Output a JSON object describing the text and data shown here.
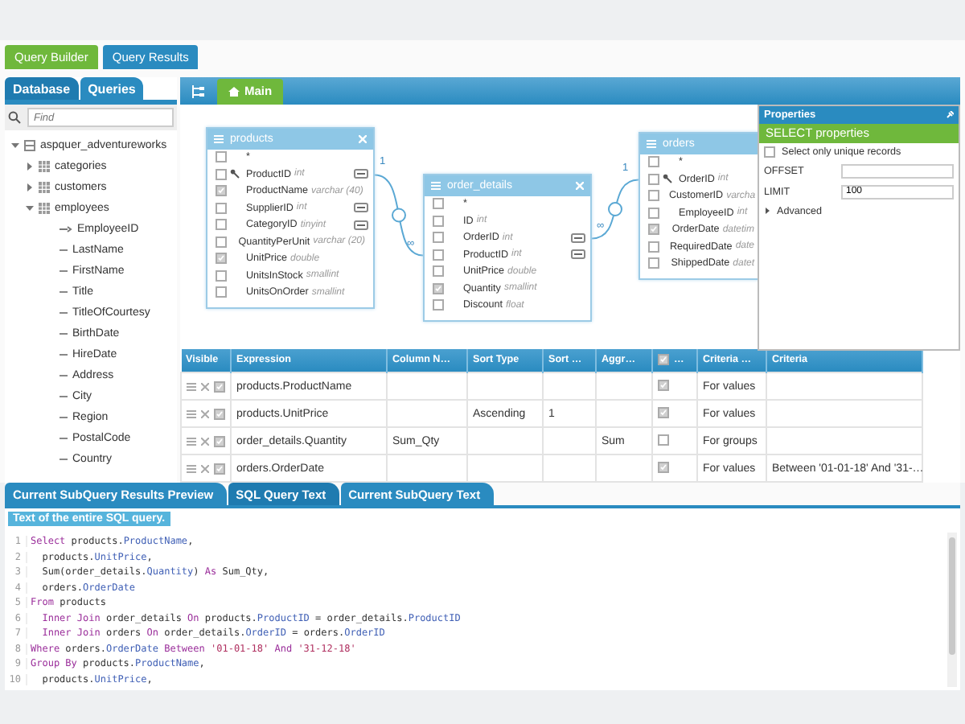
{
  "top_tabs": [
    {
      "label": "Query Builder",
      "selected": true
    },
    {
      "label": "Query Results",
      "selected": false
    }
  ],
  "sidebar": {
    "tabs": [
      {
        "label": "Database",
        "selected": true
      },
      {
        "label": "Queries",
        "selected": false
      }
    ],
    "search": {
      "placeholder": "Find"
    },
    "tree": [
      {
        "label": "aspquer_adventureworks",
        "kind": "database",
        "expanded": true,
        "children": [
          {
            "label": "categories",
            "kind": "table",
            "expanded": false
          },
          {
            "label": "customers",
            "kind": "table",
            "expanded": false
          },
          {
            "label": "employees",
            "kind": "table",
            "expanded": true,
            "children": [
              {
                "label": "EmployeeID",
                "kind": "key"
              },
              {
                "label": "LastName",
                "kind": "field"
              },
              {
                "label": "FirstName",
                "kind": "field"
              },
              {
                "label": "Title",
                "kind": "field"
              },
              {
                "label": "TitleOfCourtesy",
                "kind": "field"
              },
              {
                "label": "BirthDate",
                "kind": "field"
              },
              {
                "label": "HireDate",
                "kind": "field"
              },
              {
                "label": "Address",
                "kind": "field"
              },
              {
                "label": "City",
                "kind": "field"
              },
              {
                "label": "Region",
                "kind": "field"
              },
              {
                "label": "PostalCode",
                "kind": "field"
              },
              {
                "label": "Country",
                "kind": "field"
              }
            ]
          }
        ]
      }
    ]
  },
  "designer": {
    "tabs": [
      {
        "label": "Main",
        "selected": true
      }
    ],
    "tables": [
      {
        "title": "products",
        "closable": true,
        "fields": [
          {
            "name": "*",
            "checked": false
          },
          {
            "name": "ProductID",
            "type": "int",
            "checked": false,
            "key": true,
            "link": true
          },
          {
            "name": "ProductName",
            "type": "varchar (40)",
            "checked": true
          },
          {
            "name": "SupplierID",
            "type": "int",
            "checked": false,
            "link": true
          },
          {
            "name": "CategoryID",
            "type": "tinyint",
            "checked": false,
            "link": true
          },
          {
            "name": "QuantityPerUnit",
            "type": "varchar (20)",
            "checked": false
          },
          {
            "name": "UnitPrice",
            "type": "double",
            "checked": true
          },
          {
            "name": "UnitsInStock",
            "type": "smallint",
            "checked": false
          },
          {
            "name": "UnitsOnOrder",
            "type": "smallint",
            "checked": false
          }
        ]
      },
      {
        "title": "order_details",
        "closable": true,
        "fields": [
          {
            "name": "*",
            "checked": false
          },
          {
            "name": "ID",
            "type": "int",
            "checked": false
          },
          {
            "name": "OrderID",
            "type": "int",
            "checked": false,
            "link": true
          },
          {
            "name": "ProductID",
            "type": "int",
            "checked": false,
            "link": true
          },
          {
            "name": "UnitPrice",
            "type": "double",
            "checked": false
          },
          {
            "name": "Quantity",
            "type": "smallint",
            "checked": true
          },
          {
            "name": "Discount",
            "type": "float",
            "checked": false
          }
        ]
      },
      {
        "title": "orders",
        "closable": false,
        "fields": [
          {
            "name": "*",
            "checked": false
          },
          {
            "name": "OrderID",
            "type": "int",
            "checked": false,
            "key": true
          },
          {
            "name": "CustomerID",
            "type": "varcha",
            "checked": false
          },
          {
            "name": "EmployeeID",
            "type": "int",
            "checked": false
          },
          {
            "name": "OrderDate",
            "type": "datetim",
            "checked": true
          },
          {
            "name": "RequiredDate",
            "type": "date",
            "checked": false
          },
          {
            "name": "ShippedDate",
            "type": "datet",
            "checked": false
          }
        ]
      }
    ],
    "relations": [
      {
        "from_label": "1",
        "to_label": "∞"
      },
      {
        "from_label": "∞",
        "to_label": "1"
      }
    ]
  },
  "properties": {
    "title": "Properties",
    "section": "SELECT properties",
    "unique": {
      "label": "Select only unique records",
      "checked": false
    },
    "fields": [
      {
        "label": "OFFSET"
      },
      {
        "label": "LIMIT",
        "value": "100"
      }
    ],
    "advanced": {
      "label": "Advanced",
      "expanded": false
    }
  },
  "grid": {
    "columns": [
      {
        "kind": "visible",
        "label": "Visible"
      },
      {
        "kind": "expression",
        "label": "Expression"
      },
      {
        "kind": "alias",
        "label": "Column N…"
      },
      {
        "kind": "sort_type",
        "label": "Sort Type"
      },
      {
        "kind": "sort_order",
        "label": "Sort …"
      },
      {
        "kind": "aggregate",
        "label": "Aggr…"
      },
      {
        "kind": "output",
        "label": "…",
        "checked": true
      },
      {
        "kind": "criteria_for",
        "label": "Criteria …"
      },
      {
        "kind": "criteria",
        "label": "Criteria"
      }
    ],
    "rows": [
      {
        "visible": true,
        "expression": "products.ProductName",
        "output": true,
        "criteria_for": "For values"
      },
      {
        "visible": true,
        "expression": "products.UnitPrice",
        "sort_type": "Ascending",
        "sort_order": "1",
        "output": true,
        "criteria_for": "For values"
      },
      {
        "visible": true,
        "expression": "order_details.Quantity",
        "alias": "Sum_Qty",
        "aggregate": "Sum",
        "output": false,
        "criteria_for": "For groups"
      },
      {
        "visible": true,
        "expression": "orders.OrderDate",
        "output": true,
        "criteria_for": "For values",
        "criteria": "Between '01-01-18' And '31-…"
      }
    ]
  },
  "bottom": {
    "tabs": [
      {
        "label": "Current SubQuery Results Preview",
        "selected": false
      },
      {
        "label": "SQL Query Text",
        "selected": true
      },
      {
        "label": "Current SubQuery Text",
        "selected": false
      }
    ],
    "caption": "Text of the entire SQL query.",
    "lines": [
      {
        "number": "1",
        "tokens": [
          {
            "kind": "keyword",
            "text": "Select"
          },
          {
            "kind": "plain",
            "text": " products."
          },
          {
            "kind": "field",
            "text": "ProductName"
          },
          {
            "kind": "plain",
            "text": ","
          }
        ]
      },
      {
        "number": "2",
        "tokens": [
          {
            "kind": "plain",
            "text": "  products."
          },
          {
            "kind": "field",
            "text": "UnitPrice"
          },
          {
            "kind": "plain",
            "text": ","
          }
        ]
      },
      {
        "number": "3",
        "tokens": [
          {
            "kind": "plain",
            "text": "  Sum(order_details."
          },
          {
            "kind": "field",
            "text": "Quantity"
          },
          {
            "kind": "plain",
            "text": ") "
          },
          {
            "kind": "keyword",
            "text": "As"
          },
          {
            "kind": "plain",
            "text": " Sum_Qty,"
          }
        ]
      },
      {
        "number": "4",
        "tokens": [
          {
            "kind": "plain",
            "text": "  orders."
          },
          {
            "kind": "field",
            "text": "OrderDate"
          }
        ]
      },
      {
        "number": "5",
        "tokens": [
          {
            "kind": "keyword",
            "text": "From"
          },
          {
            "kind": "plain",
            "text": " products"
          }
        ]
      },
      {
        "number": "6",
        "tokens": [
          {
            "kind": "keyword",
            "text": "  Inner Join"
          },
          {
            "kind": "plain",
            "text": " order_details "
          },
          {
            "kind": "keyword",
            "text": "On"
          },
          {
            "kind": "plain",
            "text": " products."
          },
          {
            "kind": "field",
            "text": "ProductID"
          },
          {
            "kind": "plain",
            "text": " = order_details."
          },
          {
            "kind": "field",
            "text": "ProductID"
          }
        ]
      },
      {
        "number": "7",
        "tokens": [
          {
            "kind": "keyword",
            "text": "  Inner Join"
          },
          {
            "kind": "plain",
            "text": " orders "
          },
          {
            "kind": "keyword",
            "text": "On"
          },
          {
            "kind": "plain",
            "text": " order_details."
          },
          {
            "kind": "field",
            "text": "OrderID"
          },
          {
            "kind": "plain",
            "text": " = orders."
          },
          {
            "kind": "field",
            "text": "OrderID"
          }
        ]
      },
      {
        "number": "8",
        "tokens": [
          {
            "kind": "keyword",
            "text": "Where"
          },
          {
            "kind": "plain",
            "text": " orders."
          },
          {
            "kind": "field",
            "text": "OrderDate"
          },
          {
            "kind": "keyword",
            "text": " Between "
          },
          {
            "kind": "string",
            "text": "'01-01-18'"
          },
          {
            "kind": "keyword",
            "text": " And "
          },
          {
            "kind": "string",
            "text": "'31-12-18'"
          }
        ]
      },
      {
        "number": "9",
        "tokens": [
          {
            "kind": "keyword",
            "text": "Group By"
          },
          {
            "kind": "plain",
            "text": " products."
          },
          {
            "kind": "field",
            "text": "ProductName"
          },
          {
            "kind": "plain",
            "text": ","
          }
        ]
      },
      {
        "number": "10",
        "tokens": [
          {
            "kind": "plain",
            "text": "  products."
          },
          {
            "kind": "field",
            "text": "UnitPrice"
          },
          {
            "kind": "plain",
            "text": ","
          }
        ]
      }
    ]
  }
}
